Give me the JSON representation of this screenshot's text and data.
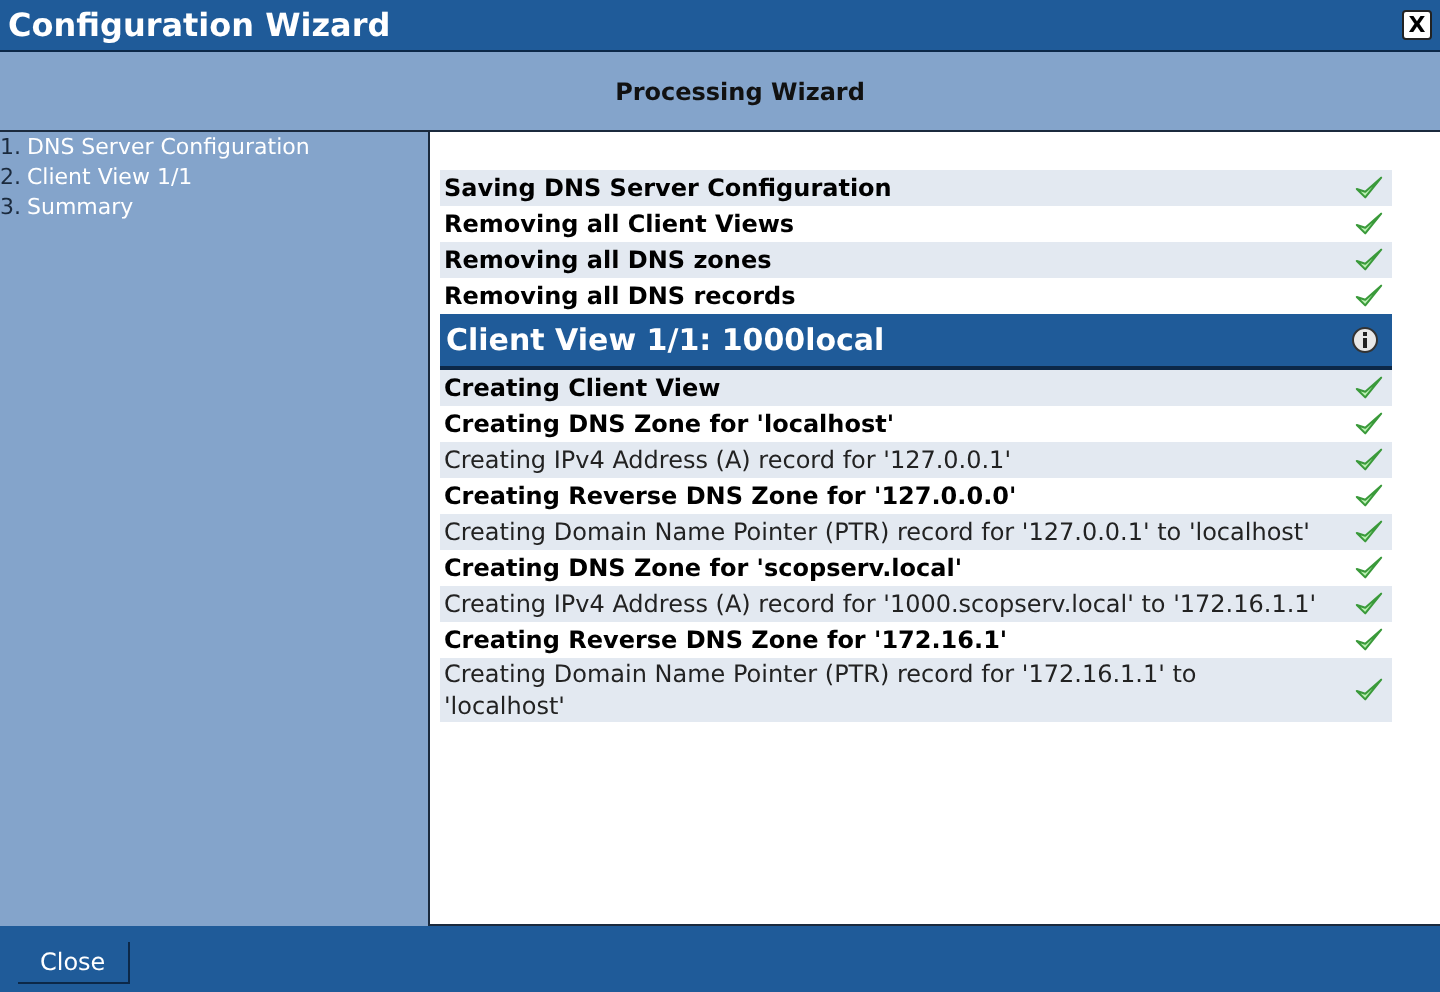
{
  "window": {
    "title": "Configuration Wizard",
    "close": "X"
  },
  "heading": "Processing Wizard",
  "steps": [
    {
      "number": "1.",
      "label": "DNS Server Configuration"
    },
    {
      "number": "2.",
      "label": "Client View 1/1"
    },
    {
      "number": "3.",
      "label": "Summary"
    }
  ],
  "sections": [
    {
      "rows": [
        {
          "kind": "task",
          "text": "Saving DNS Server Configuration",
          "done": true
        },
        {
          "kind": "task",
          "text": "Removing all Client Views",
          "done": true
        },
        {
          "kind": "task",
          "text": "Removing all DNS zones",
          "done": true
        },
        {
          "kind": "task",
          "text": "Removing all DNS records",
          "done": true
        }
      ]
    },
    {
      "title": "Client View 1/1: 1000local",
      "info": true,
      "rows": [
        {
          "kind": "task",
          "text": "Creating Client View",
          "done": true
        },
        {
          "kind": "task",
          "text": "Creating DNS Zone for 'localhost'",
          "done": true
        },
        {
          "kind": "record",
          "text": "Creating IPv4 Address (A) record for '127.0.0.1'",
          "done": true
        },
        {
          "kind": "task",
          "text": "Creating Reverse DNS Zone for '127.0.0.0'",
          "done": true
        },
        {
          "kind": "record",
          "text": "Creating Domain Name Pointer (PTR) record for '127.0.0.1' to 'localhost'",
          "done": true
        },
        {
          "kind": "task",
          "text": "Creating DNS Zone for 'scopserv.local'",
          "done": true
        },
        {
          "kind": "record",
          "text": "Creating IPv4 Address (A) record for '1000.scopserv.local' to '172.16.1.1'",
          "done": true
        },
        {
          "kind": "task",
          "text": "Creating Reverse DNS Zone for '172.16.1'",
          "done": true
        },
        {
          "kind": "record",
          "text": "Creating Domain Name Pointer (PTR) record for '172.16.1.1' to 'localhost'",
          "done": true
        }
      ]
    }
  ],
  "buttons": [
    "Close"
  ]
}
